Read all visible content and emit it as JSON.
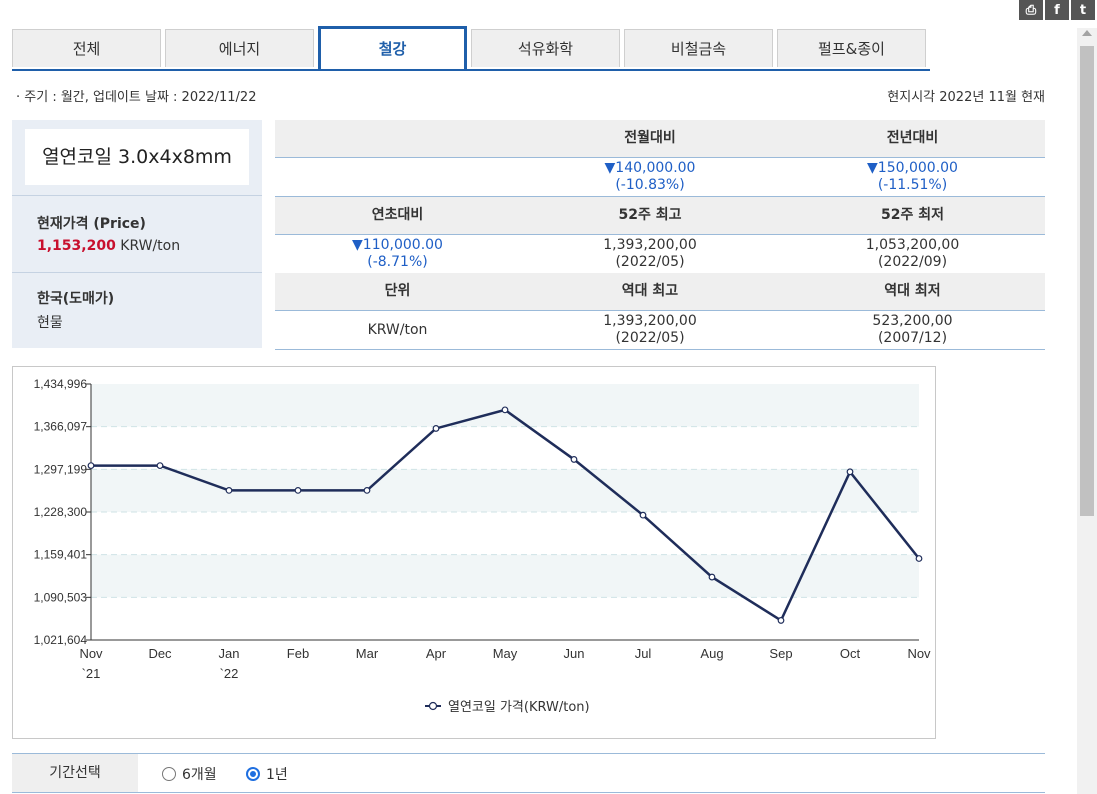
{
  "tabs": [
    "전체",
    "에너지",
    "철강",
    "석유화학",
    "비철금속",
    "펄프&종이"
  ],
  "active_tab": 2,
  "info": {
    "cycle_update": "· 주기 : 월간, 업데이트 날짜 : 2022/11/22",
    "local_time": "현지시각 2022년 11월 현재"
  },
  "product": {
    "name": "열연코일 3.0x4x8mm",
    "price_label": "현재가격 (Price)",
    "price_value": "1,153,200",
    "price_unit": "KRW/ton",
    "market": "한국(도매가)",
    "type": "현물"
  },
  "stats": {
    "mom_label": "전월대비",
    "yoy_label": "전년대비",
    "mom_value": "▼140,000.00",
    "mom_pct": "(-10.83%)",
    "yoy_value": "▼150,000.00",
    "yoy_pct": "(-11.51%)",
    "ytd_label": "연초대비",
    "high52_label": "52주 최고",
    "low52_label": "52주 최저",
    "ytd_value": "▼110,000.00",
    "ytd_pct": "(-8.71%)",
    "high52_value": "1,393,200,00",
    "high52_date": "(2022/05)",
    "low52_value": "1,053,200,00",
    "low52_date": "(2022/09)",
    "unit_label": "단위",
    "alltime_high_label": "역대 최고",
    "alltime_low_label": "역대 최저",
    "unit_value": "KRW/ton",
    "alltime_high_value": "1,393,200,00",
    "alltime_high_date": "(2022/05)",
    "alltime_low_value": "523,200,00",
    "alltime_low_date": "(2007/12)"
  },
  "chart_data": {
    "type": "line",
    "categories": [
      "Nov",
      "Dec",
      "Jan",
      "Feb",
      "Mar",
      "Apr",
      "May",
      "Jun",
      "Jul",
      "Aug",
      "Sep",
      "Oct",
      "Nov"
    ],
    "category_sublabels": [
      "`21",
      "",
      "`22",
      "",
      "",
      "",
      "",
      "",
      "",
      "",
      "",
      "",
      ""
    ],
    "series": [
      {
        "name": "열연코일 가격(KRW/ton)",
        "values": [
          1303200,
          1303200,
          1263200,
          1263200,
          1263200,
          1363200,
          1393200,
          1313200,
          1223200,
          1123200,
          1053200,
          1293200,
          1153200
        ],
        "color": "#1f2d5a"
      }
    ],
    "ylim": [
      1021604,
      1434996
    ],
    "yticks": [
      1021604,
      1090503,
      1159401,
      1228300,
      1297199,
      1366097,
      1434996
    ],
    "ytick_labels": [
      "1,021,604",
      "1,090,503",
      "1,159,401",
      "1,228,300",
      "1,297,199",
      "1,366,097",
      "1,434,996"
    ],
    "grid": true,
    "legend": "bottom"
  },
  "period": {
    "label": "기간선택",
    "options": [
      "6개월",
      "1년"
    ],
    "selected": 1
  },
  "colors": {
    "accent": "#1f5faa",
    "down": "#1f5fc6",
    "price": "#c8102e",
    "line": "#1f2d5a"
  },
  "icons": [
    "print-icon",
    "facebook-icon",
    "twitter-icon"
  ]
}
